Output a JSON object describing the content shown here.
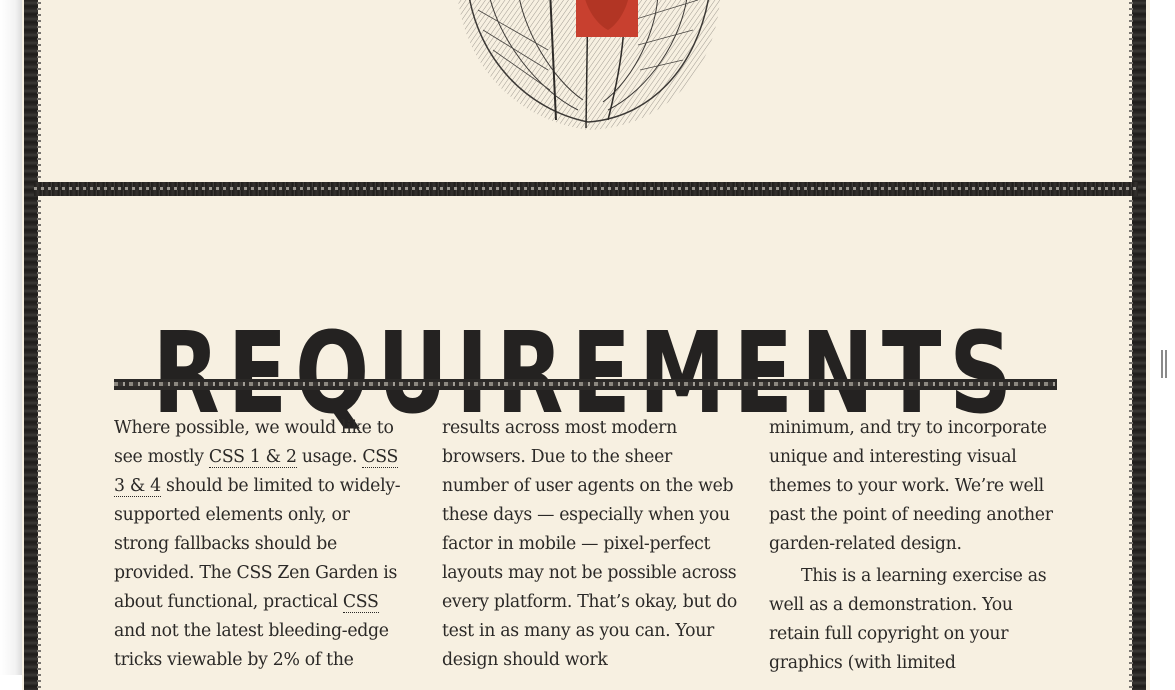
{
  "section": {
    "heading": "REQUIREMENTS"
  },
  "columns": {
    "col1": {
      "t1": "Where possible, we would like to see mostly ",
      "abbr1": "CSS 1 & 2",
      "t2": " usage. ",
      "abbr2": "CSS 3 & 4",
      "t3": " should be limited to widely-supported elements only, or strong fallbacks should be provided. The CSS Zen Garden is about functional, practical ",
      "abbr3": "CSS",
      "t4": " and not the latest bleeding-edge tricks viewable by 2% of the"
    },
    "col2": {
      "text": "results across most modern browsers. Due to the sheer number of user agents on the web these days — especially when you factor in mobile — pixel-perfect layouts may not be possible across every platform. That’s okay, but do test in as many as you can. Your design should work"
    },
    "col3": {
      "p1": "minimum, and try to incorporate unique and interesting visual themes to your work. We’re well past the point of needing another garden-related design.",
      "p2": "This is a learning exercise as well as a demonstration. You retain full copyright on your graphics (with limited"
    }
  },
  "colors": {
    "paper": "#f7f0e1",
    "ink": "#242221",
    "accent": "#c8402f"
  },
  "icons": {
    "illustration": "anatomical-heart-illustration",
    "scroll": "scrollbar-grip-icon"
  }
}
